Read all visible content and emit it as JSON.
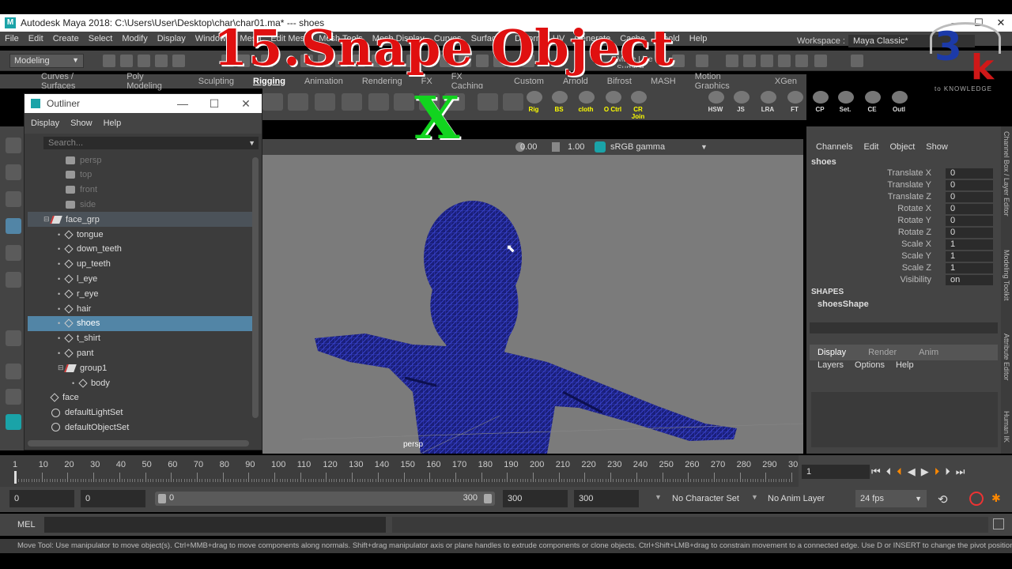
{
  "window": {
    "title": "Autodesk Maya 2018: C:\\Users\\User\\Desktop\\char\\char01.ma*   ---   shoes",
    "min": "—",
    "max": "☐",
    "close": "✕"
  },
  "menu": [
    "File",
    "Edit",
    "Create",
    "Select",
    "Modify",
    "Display",
    "Windows",
    "Mesh",
    "Edit Mesh",
    "Mesh Tools",
    "Mesh Display",
    "Curves",
    "Surfaces",
    "Deform",
    "UV",
    "Generate",
    "Cache",
    "Arnold",
    "Help"
  ],
  "workspace": {
    "label": "Workspace :",
    "value": "Maya Classic*"
  },
  "mode": "Modeling",
  "live_surface": "Make Live Surface",
  "shelf_tabs": [
    "Curves / Surfaces",
    "Poly Modeling",
    "Sculpting",
    "Rigging",
    "Animation",
    "Rendering",
    "FX",
    "FX Caching",
    "Custom",
    "Arnold",
    "Bifrost",
    "MASH",
    "Motion Graphics",
    "XGen"
  ],
  "shelf_active": "Rigging",
  "shelf_labels": [
    "Rig",
    "BS",
    "cloth",
    "O Ctrl",
    "CR Join",
    "HSW",
    "JS",
    "LRA",
    "FT",
    "CP",
    "Set.",
    "CE",
    "Outl"
  ],
  "outliner": {
    "title": "Outliner",
    "menu": [
      "Display",
      "Show",
      "Help"
    ],
    "search_placeholder": "Search...",
    "items": [
      {
        "label": "persp",
        "type": "camera",
        "indent": 1,
        "state": "dim"
      },
      {
        "label": "top",
        "type": "camera",
        "indent": 1,
        "state": "dim"
      },
      {
        "label": "front",
        "type": "camera",
        "indent": 1,
        "state": "dim"
      },
      {
        "label": "side",
        "type": "camera",
        "indent": 1,
        "state": "dim"
      },
      {
        "label": "face_grp",
        "type": "group",
        "indent": 0,
        "state": "grp",
        "expand": "⊟"
      },
      {
        "label": "tongue",
        "type": "mesh",
        "indent": 1,
        "state": ""
      },
      {
        "label": "down_teeth",
        "type": "mesh",
        "indent": 1,
        "state": ""
      },
      {
        "label": "up_teeth",
        "type": "mesh",
        "indent": 1,
        "state": ""
      },
      {
        "label": "l_eye",
        "type": "mesh",
        "indent": 1,
        "state": ""
      },
      {
        "label": "r_eye",
        "type": "mesh",
        "indent": 1,
        "state": ""
      },
      {
        "label": "hair",
        "type": "mesh",
        "indent": 1,
        "state": ""
      },
      {
        "label": "shoes",
        "type": "mesh",
        "indent": 1,
        "state": "sel"
      },
      {
        "label": "t_shirt",
        "type": "mesh",
        "indent": 1,
        "state": ""
      },
      {
        "label": "pant",
        "type": "mesh",
        "indent": 1,
        "state": ""
      },
      {
        "label": "group1",
        "type": "group",
        "indent": 1,
        "state": "",
        "expand": "⊟"
      },
      {
        "label": "body",
        "type": "mesh",
        "indent": 2,
        "state": ""
      },
      {
        "label": "face",
        "type": "mesh",
        "indent": 0,
        "state": ""
      },
      {
        "label": "defaultLightSet",
        "type": "set",
        "indent": 0,
        "state": ""
      },
      {
        "label": "defaultObjectSet",
        "type": "set",
        "indent": 0,
        "state": ""
      }
    ]
  },
  "viewport": {
    "val1": "0.00",
    "val2": "1.00",
    "colorspace": "sRGB gamma",
    "camera": "persp"
  },
  "channelbox": {
    "menu": [
      "Channels",
      "Edit",
      "Object",
      "Show"
    ],
    "object": "shoes",
    "attrs": [
      {
        "name": "Translate X",
        "value": "0"
      },
      {
        "name": "Translate Y",
        "value": "0"
      },
      {
        "name": "Translate Z",
        "value": "0"
      },
      {
        "name": "Rotate X",
        "value": "0"
      },
      {
        "name": "Rotate Y",
        "value": "0"
      },
      {
        "name": "Rotate Z",
        "value": "0"
      },
      {
        "name": "Scale X",
        "value": "1"
      },
      {
        "name": "Scale Y",
        "value": "1"
      },
      {
        "name": "Scale Z",
        "value": "1"
      },
      {
        "name": "Visibility",
        "value": "on"
      }
    ],
    "shapes_header": "SHAPES",
    "shape": "shoesShape",
    "layer_tabs": [
      "Display",
      "Render",
      "Anim"
    ],
    "layer_menu": [
      "Layers",
      "Options",
      "Help"
    ]
  },
  "side_tabs": [
    "Channel Box / Layer Editor",
    "Modeling Toolkit",
    "Attribute Editor",
    "Human IK"
  ],
  "timeline": {
    "ticks": [
      "1",
      "10",
      "20",
      "30",
      "40",
      "50",
      "60",
      "70",
      "80",
      "90",
      "100",
      "110",
      "120",
      "130",
      "140",
      "150",
      "160",
      "170",
      "180",
      "190",
      "200",
      "210",
      "220",
      "230",
      "240",
      "250",
      "260",
      "270",
      "280",
      "290",
      "30"
    ],
    "current": "1"
  },
  "range": {
    "start": "0",
    "playstart": "0",
    "slider_start": "0",
    "slider_end": "300",
    "end": "300",
    "playend": "300",
    "character": "No Character Set",
    "anim_layer": "No Anim Layer",
    "fps": "24 fps"
  },
  "cmd": {
    "label": "MEL"
  },
  "help": "Move Tool: Use manipulator to move object(s). Ctrl+MMB+drag to move components along normals. Shift+drag manipulator axis or plane handles to extrude components or clone objects. Ctrl+Shift+LMB+drag to constrain movement to a connected edge. Use D or INSERT to change the pivot position a",
  "overlay": {
    "title": "15.Snape Object",
    "mark": "X",
    "logo": "3K",
    "logo_sub": "to KNOWLEDGE"
  }
}
